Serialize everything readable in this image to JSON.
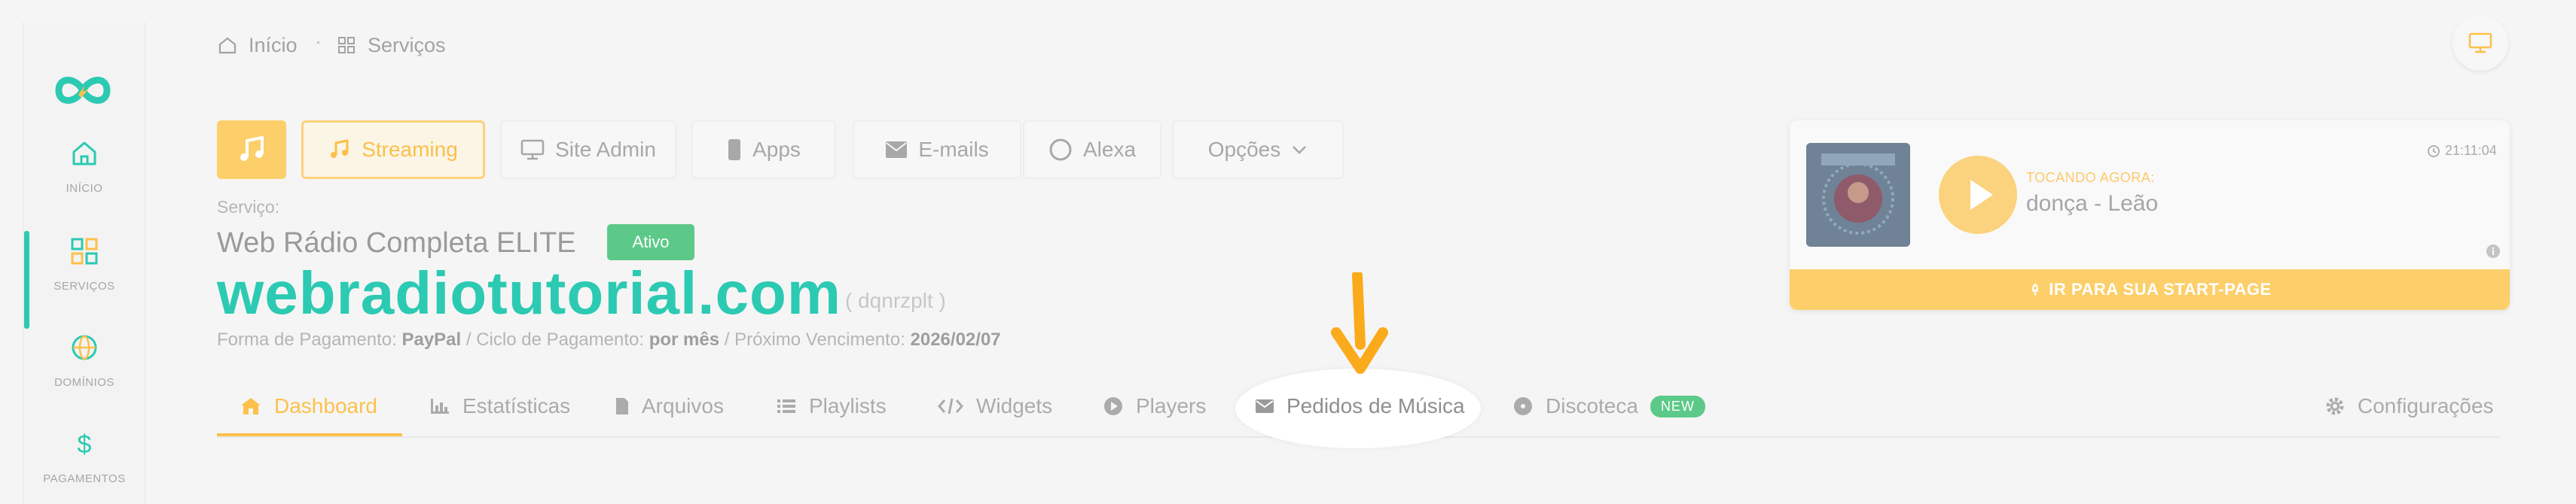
{
  "sidebar": {
    "items": [
      {
        "label": "INÍCIO",
        "icon": "home-icon"
      },
      {
        "label": "SERVIÇOS",
        "icon": "grid-icon"
      },
      {
        "label": "DOMÍNIOS",
        "icon": "globe-icon"
      },
      {
        "label": "PAGAMENTOS",
        "icon": "dollar-icon"
      }
    ],
    "active": "SERVIÇOS"
  },
  "breadcrumb": {
    "home": "Início",
    "separator": "·",
    "current": "Serviços"
  },
  "service_tabs": {
    "streaming": "Streaming",
    "site_admin": "Site Admin",
    "apps": "Apps",
    "emails": "E-mails",
    "alexa": "Alexa",
    "opcoes": "Opções"
  },
  "service": {
    "label": "Serviço:",
    "plan": "Web Rádio Completa ELITE",
    "status": "Ativo",
    "domain": "webradiotutorial.com",
    "code": "( dqnrzplt )",
    "payment_label": "Forma de Pagamento:",
    "payment_value": "PayPal",
    "cycle_label": "/ Ciclo de Pagamento:",
    "cycle_value": "por mês",
    "due_label": "/ Próximo Vencimento:",
    "due_value": "2026/02/07"
  },
  "nav_tabs": {
    "dashboard": "Dashboard",
    "estatisticas": "Estatísticas",
    "arquivos": "Arquivos",
    "playlists": "Playlists",
    "widgets": "Widgets",
    "players": "Players",
    "pedidos": "Pedidos de Música",
    "discoteca": "Discoteca",
    "new_badge": "NEW",
    "configuracoes": "Configurações"
  },
  "player": {
    "now_playing_label": "TOCANDO AGORA:",
    "song": "donça - Leão",
    "time": "21:11:04",
    "start_page": "IR PARA SUA START-PAGE"
  },
  "colors": {
    "brand_teal": "#2ccab2",
    "accent_yellow": "#fcc14c",
    "status_green": "#5cc989",
    "arrow_orange": "#fbaa1c"
  }
}
